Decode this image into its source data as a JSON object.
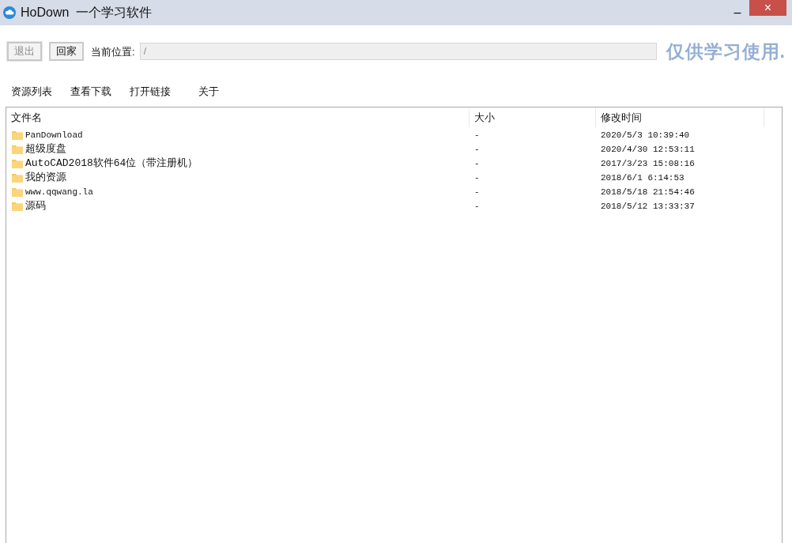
{
  "window": {
    "title": "HoDown  一个学习软件",
    "minimize": "–",
    "close": "×"
  },
  "toolbar": {
    "buttons": [
      {
        "label": "退出",
        "disabled": true
      },
      {
        "label": "回家",
        "disabled": false
      }
    ],
    "location_label": "当前位置:",
    "location_value": "/",
    "notice": "仅供学习使用."
  },
  "menu": [
    "资源列表",
    "查看下载",
    "打开链接",
    "关于"
  ],
  "table": {
    "columns": [
      "文件名",
      "大小",
      "修改时间"
    ],
    "rows": [
      {
        "name": "PanDownload",
        "size": "-",
        "modified": "2020/5/3 10:39:40"
      },
      {
        "name": "超级度盘",
        "size": "-",
        "modified": "2020/4/30 12:53:11"
      },
      {
        "name": "AutoCAD2018软件64位（带注册机）",
        "size": "-",
        "modified": "2017/3/23 15:08:16"
      },
      {
        "name": "我的资源",
        "size": "-",
        "modified": "2018/6/1 6:14:53"
      },
      {
        "name": "www.qqwang.la",
        "size": "-",
        "modified": "2018/5/18 21:54:46"
      },
      {
        "name": "源码",
        "size": "-",
        "modified": "2018/5/12 13:33:37"
      }
    ]
  }
}
